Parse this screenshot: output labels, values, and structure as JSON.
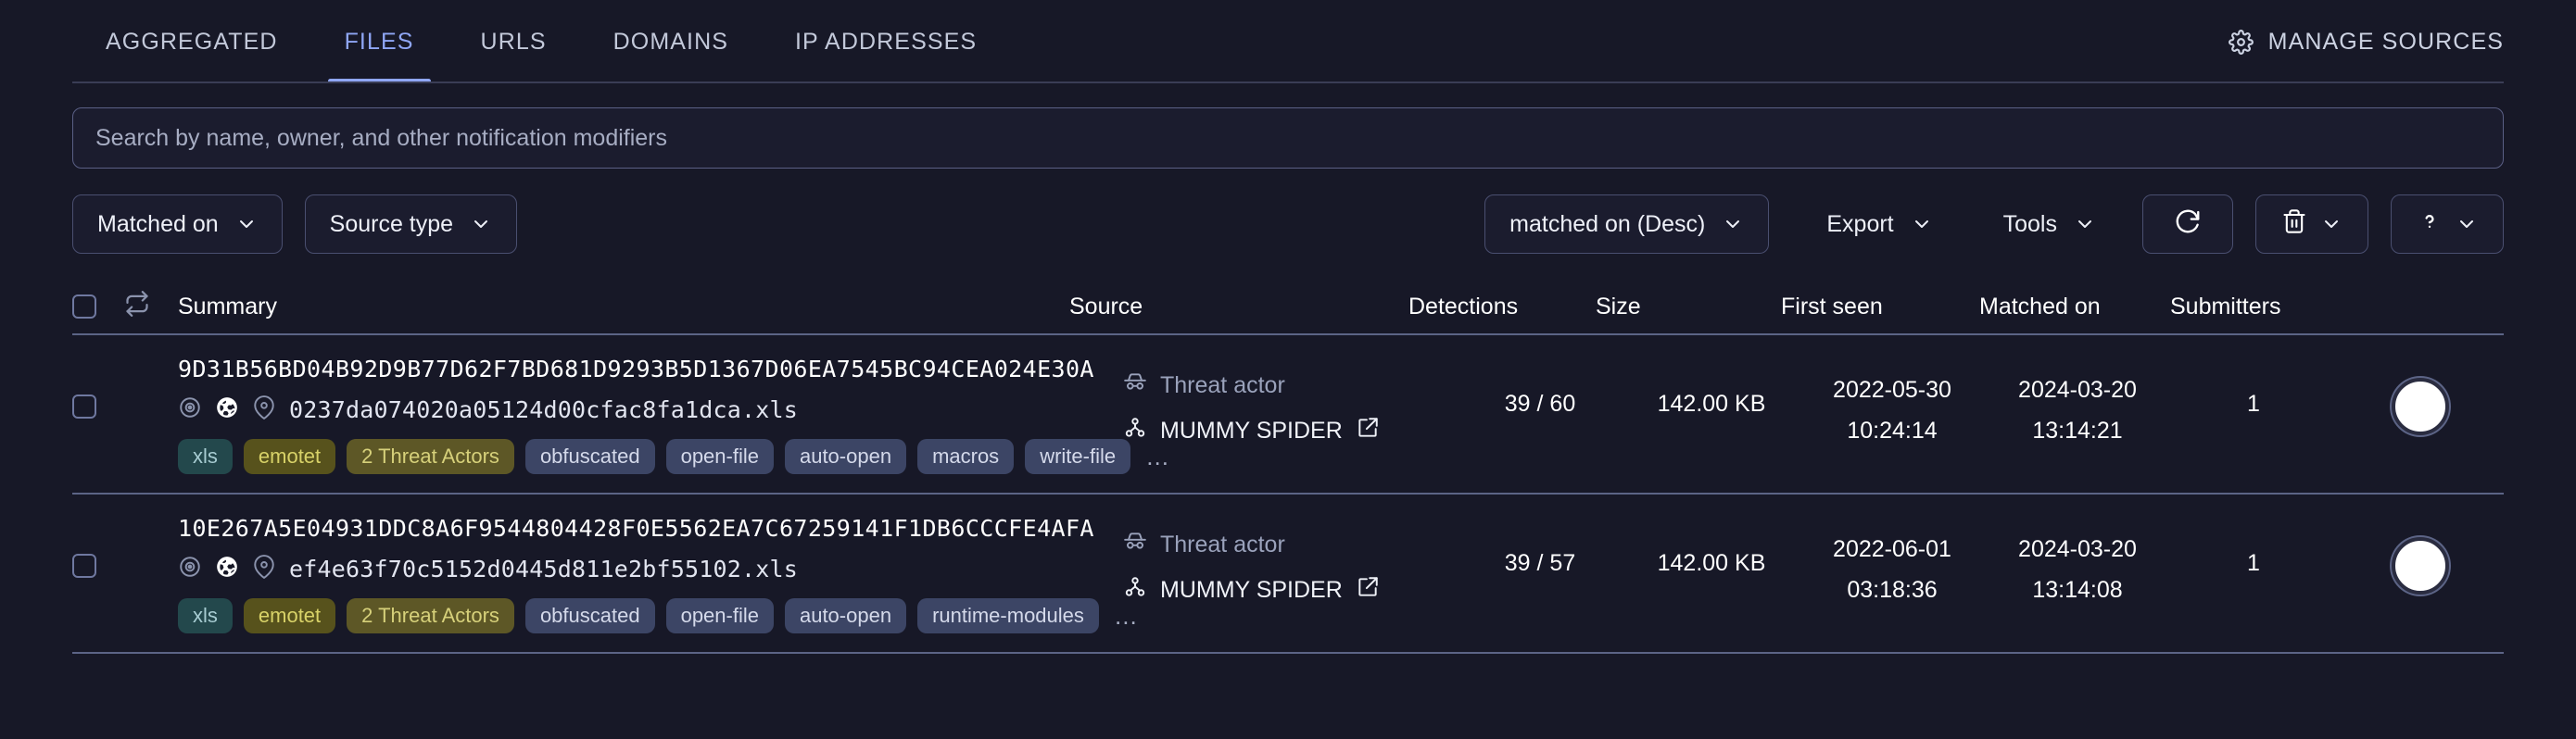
{
  "tabs": [
    {
      "label": "AGGREGATED",
      "active": false
    },
    {
      "label": "FILES",
      "active": true
    },
    {
      "label": "URLS",
      "active": false
    },
    {
      "label": "DOMAINS",
      "active": false
    },
    {
      "label": "IP ADDRESSES",
      "active": false
    }
  ],
  "manage_sources": {
    "label": "MANAGE SOURCES",
    "icon": "gear-icon"
  },
  "search": {
    "placeholder": "Search by name, owner, and other notification modifiers",
    "value": ""
  },
  "toolbar": {
    "matched_on_filter": "Matched on",
    "source_type_filter": "Source type",
    "sort": "matched on (Desc)",
    "export": "Export",
    "tools": "Tools",
    "refresh_icon": "refresh-icon",
    "delete_icon": "trash-icon",
    "help_icon": "question-mark-icon"
  },
  "table": {
    "columns": {
      "summary": "Summary",
      "source": "Source",
      "detections": "Detections",
      "size": "Size",
      "first_seen": "First seen",
      "matched_on": "Matched on",
      "submitters": "Submitters"
    },
    "rows": [
      {
        "hash": "9D31B56BD04B92D9B77D62F7BD681D9293B5D1367D06EA7545BC94CEA024E30A",
        "filename": "0237da074020a05124d00cfac8fa1dca.xls",
        "tags": [
          {
            "label": "xls",
            "color": "teal"
          },
          {
            "label": "emotet",
            "color": "olive"
          },
          {
            "label": "2 Threat Actors",
            "color": "olive2"
          },
          {
            "label": "obfuscated",
            "color": "blue"
          },
          {
            "label": "open-file",
            "color": "blue"
          },
          {
            "label": "auto-open",
            "color": "blue"
          },
          {
            "label": "macros",
            "color": "blue"
          },
          {
            "label": "write-file",
            "color": "blue"
          }
        ],
        "tags_more": "…",
        "source_type": "Threat actor",
        "source_name": "MUMMY SPIDER",
        "detections": "39 / 60",
        "size": "142.00 KB",
        "first_seen_date": "2022-05-30",
        "first_seen_time": "10:24:14",
        "matched_on_date": "2024-03-20",
        "matched_on_time": "13:14:21",
        "submitters": "1"
      },
      {
        "hash": "10E267A5E04931DDC8A6F9544804428F0E5562EA7C67259141F1DB6CCCFE4AFA",
        "filename": "ef4e63f70c5152d0445d811e2bf55102.xls",
        "tags": [
          {
            "label": "xls",
            "color": "teal"
          },
          {
            "label": "emotet",
            "color": "olive"
          },
          {
            "label": "2 Threat Actors",
            "color": "olive2"
          },
          {
            "label": "obfuscated",
            "color": "blue"
          },
          {
            "label": "open-file",
            "color": "blue"
          },
          {
            "label": "auto-open",
            "color": "blue"
          },
          {
            "label": "runtime-modules",
            "color": "blue"
          }
        ],
        "tags_more": "…",
        "source_type": "Threat actor",
        "source_name": "MUMMY SPIDER",
        "detections": "39 / 57",
        "size": "142.00 KB",
        "first_seen_date": "2022-06-01",
        "first_seen_time": "03:18:36",
        "matched_on_date": "2024-03-20",
        "matched_on_time": "13:14:08",
        "submitters": "1"
      }
    ]
  },
  "colors": {
    "background": "#171827",
    "accent": "#8fa6f5",
    "panel": "#1b1c2e",
    "divider": "#5c6486"
  }
}
